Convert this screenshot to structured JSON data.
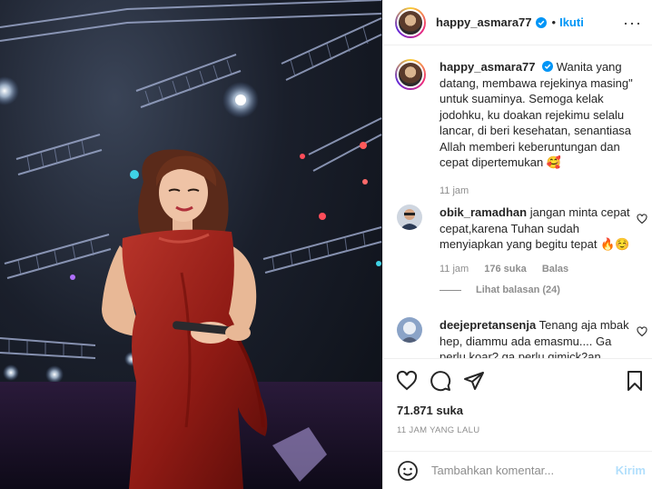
{
  "header": {
    "username": "happy_asmara77",
    "separator": "•",
    "follow_label": "Ikuti",
    "more_label": "···"
  },
  "caption": {
    "username": "happy_asmara77",
    "text": "Wanita yang datang, membawa rejekinya masing\" untuk suaminya. Semoga kelak jodohku, ku doakan rejekimu selalu lancar, di beri kesehatan, senantiasa Allah memberi keberuntungan dan cepat dipertemukan 🥰",
    "time": "11 jam"
  },
  "comments": [
    {
      "username": "obik_ramadhan",
      "text": "jangan minta cepat cepat,karena Tuhan sudah menyiapkan yang begitu tepat 🔥☺️",
      "time": "11 jam",
      "likes": "176 suka",
      "reply": "Balas",
      "view_replies": "Lihat balasan (24)"
    },
    {
      "username": "deejepretansenja",
      "text": "Tenang aja mbak hep, diammu ada emasmu.... Ga perlu koar? ga perlu gimick2an"
    }
  ],
  "actions": {
    "likes_count": "71.871 suka",
    "time_ago": "11 JAM YANG LALU"
  },
  "add_comment": {
    "placeholder": "Tambahkan komentar...",
    "post_label": "Kirim"
  },
  "colors": {
    "accent": "#0095f6",
    "muted": "#8e8e8e",
    "dress": "#8e1a14"
  }
}
